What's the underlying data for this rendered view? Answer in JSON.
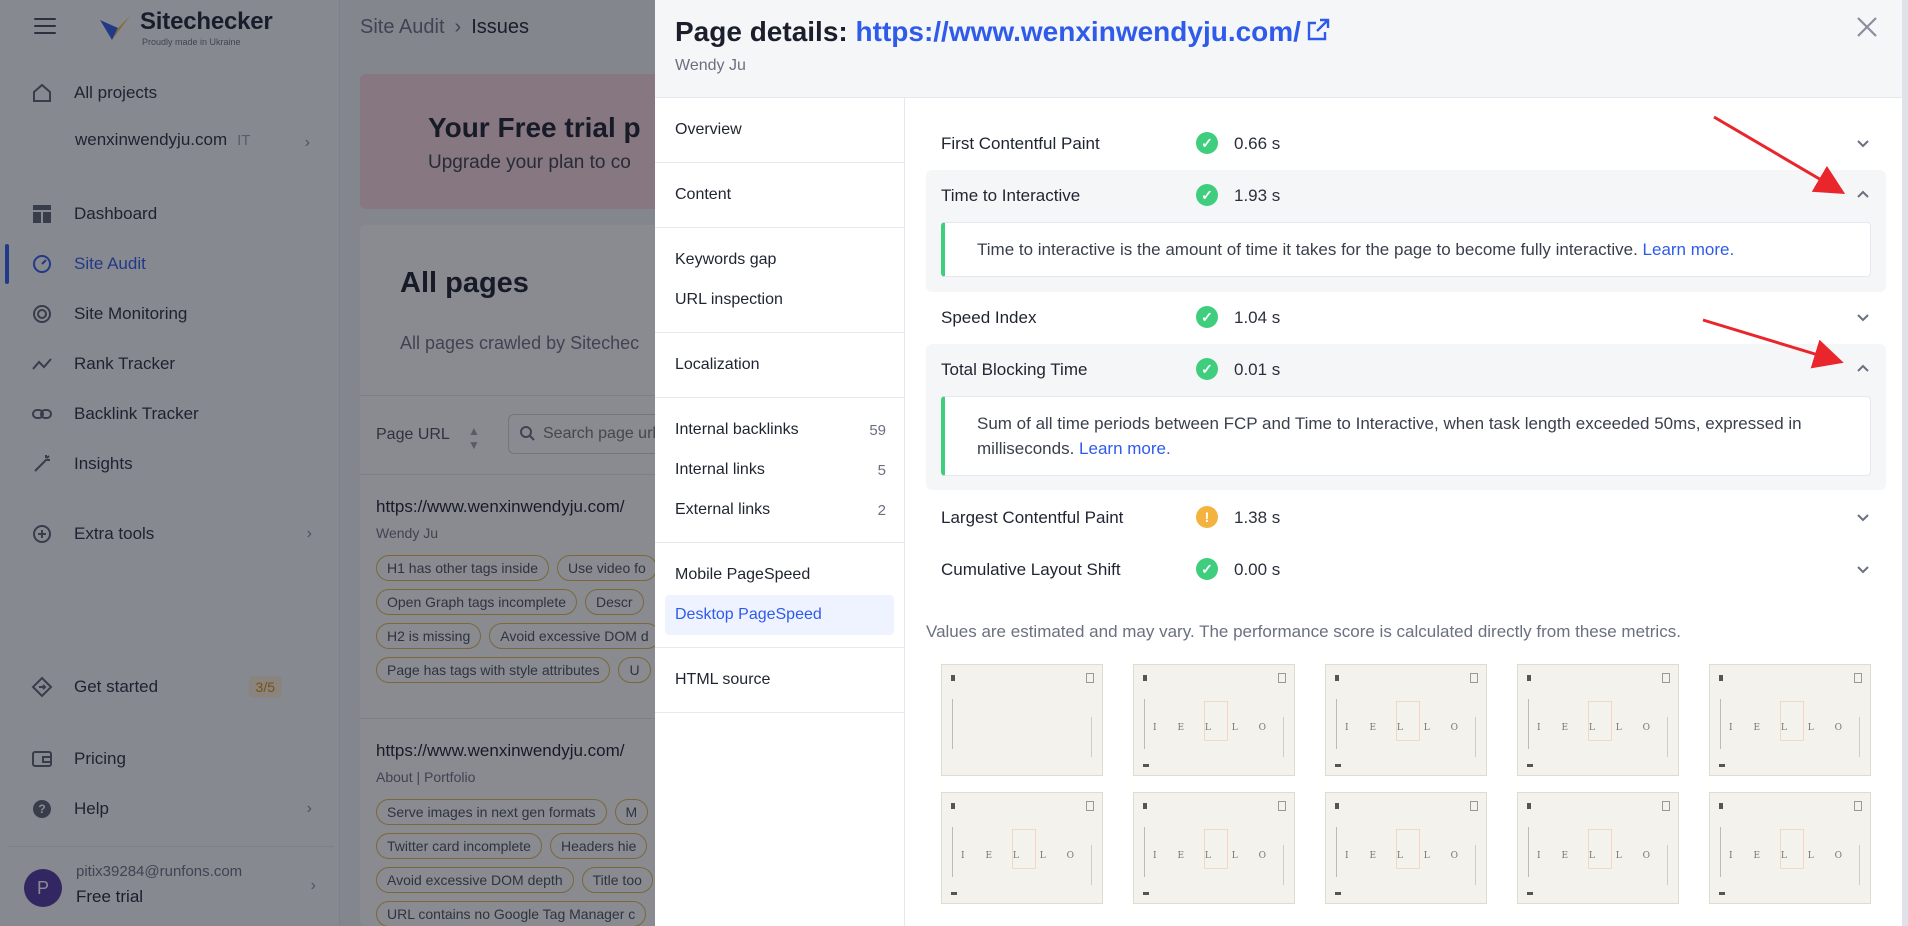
{
  "app": {
    "logo": {
      "name": "Sitechecker",
      "tagline": "Proudly made in Ukraine"
    },
    "sidebar": {
      "items": [
        {
          "label": "All projects",
          "icon": "home-icon"
        },
        {
          "label": "Dashboard",
          "icon": "dashboard-icon"
        },
        {
          "label": "Site Audit",
          "icon": "gauge-icon"
        },
        {
          "label": "Site Monitoring",
          "icon": "monitoring-icon"
        },
        {
          "label": "Rank Tracker",
          "icon": "trend-icon"
        },
        {
          "label": "Backlink Tracker",
          "icon": "link-icon"
        },
        {
          "label": "Insights",
          "icon": "magic-wand-icon"
        },
        {
          "label": "Extra tools",
          "icon": "plus-circle-icon"
        },
        {
          "label": "Get started",
          "icon": "diamond-arrow-icon"
        },
        {
          "label": "Pricing",
          "icon": "wallet-icon"
        },
        {
          "label": "Help",
          "icon": "question-icon"
        }
      ],
      "project": {
        "domain": "wenxinwendyju.com",
        "lang": "IT"
      },
      "get_started_badge": "3/5",
      "user": {
        "avatar_letter": "P",
        "email": "pitix39284@runfons.com",
        "plan": "Free trial"
      }
    },
    "breadcrumb": {
      "parent": "Site Audit",
      "current": "Issues"
    },
    "trial": {
      "title": "Your Free trial p",
      "subtitle": "Upgrade your plan to co"
    },
    "pages": {
      "title": "All pages",
      "subtitle": "All pages crawled by Sitechec",
      "column_label": "Page URL",
      "search_placeholder": "Search page url",
      "rows": [
        {
          "url": "https://www.wenxinwendyju.com/",
          "title": "Wendy Ju",
          "chips": [
            "H1 has other tags inside",
            "Use video fo",
            "Open Graph tags incomplete",
            "Descr",
            "H2 is missing",
            "Avoid excessive DOM d",
            "Page has tags with style attributes",
            "U"
          ]
        },
        {
          "url": "https://www.wenxinwendyju.com/",
          "title": "About | Portfolio",
          "chips": [
            "Serve images in next gen formats",
            "M",
            "Twitter card incomplete",
            "Headers hie",
            "Avoid excessive DOM depth",
            "Title too",
            "URL contains no Google Tag Manager c"
          ]
        }
      ]
    }
  },
  "modal": {
    "title_prefix": "Page details:",
    "url": "https://www.wenxinwendyju.com/",
    "subtitle": "Wendy Ju",
    "nav_groups": [
      [
        {
          "label": "Overview"
        }
      ],
      [
        {
          "label": "Content"
        }
      ],
      [
        {
          "label": "Keywords gap"
        },
        {
          "label": "URL inspection"
        }
      ],
      [
        {
          "label": "Localization"
        }
      ],
      [
        {
          "label": "Internal backlinks",
          "count": "59"
        },
        {
          "label": "Internal links",
          "count": "5"
        },
        {
          "label": "External links",
          "count": "2"
        }
      ],
      [
        {
          "label": "Mobile PageSpeed"
        },
        {
          "label": "Desktop PageSpeed",
          "active": true
        }
      ],
      [
        {
          "label": "HTML source"
        }
      ]
    ],
    "metrics": [
      {
        "name": "First Contentful Paint",
        "value": "0.66 s",
        "status": "good",
        "expanded": false
      },
      {
        "name": "Time to Interactive",
        "value": "1.93 s",
        "status": "good",
        "expanded": true,
        "detail": "Time to interactive is the amount of time it takes for the page to become fully interactive.",
        "link": "Learn more."
      },
      {
        "name": "Speed Index",
        "value": "1.04 s",
        "status": "good",
        "expanded": false
      },
      {
        "name": "Total Blocking Time",
        "value": "0.01 s",
        "status": "good",
        "expanded": true,
        "detail": "Sum of all time periods between FCP and Time to Interactive, when task length exceeded 50ms, expressed in milliseconds.",
        "link": "Learn more."
      },
      {
        "name": "Largest Contentful Paint",
        "value": "1.38 s",
        "status": "warn",
        "expanded": false
      },
      {
        "name": "Cumulative Layout Shift",
        "value": "0.00 s",
        "status": "good",
        "expanded": false
      }
    ],
    "note": "Values are estimated and may vary. The performance score is calculated directly from these metrics.",
    "thumbnail_text": "I E L L O",
    "colors": {
      "accent": "#2f5bea",
      "good": "#3fce7e",
      "warn": "#f4b23e",
      "arrow": "#e8262b"
    }
  }
}
